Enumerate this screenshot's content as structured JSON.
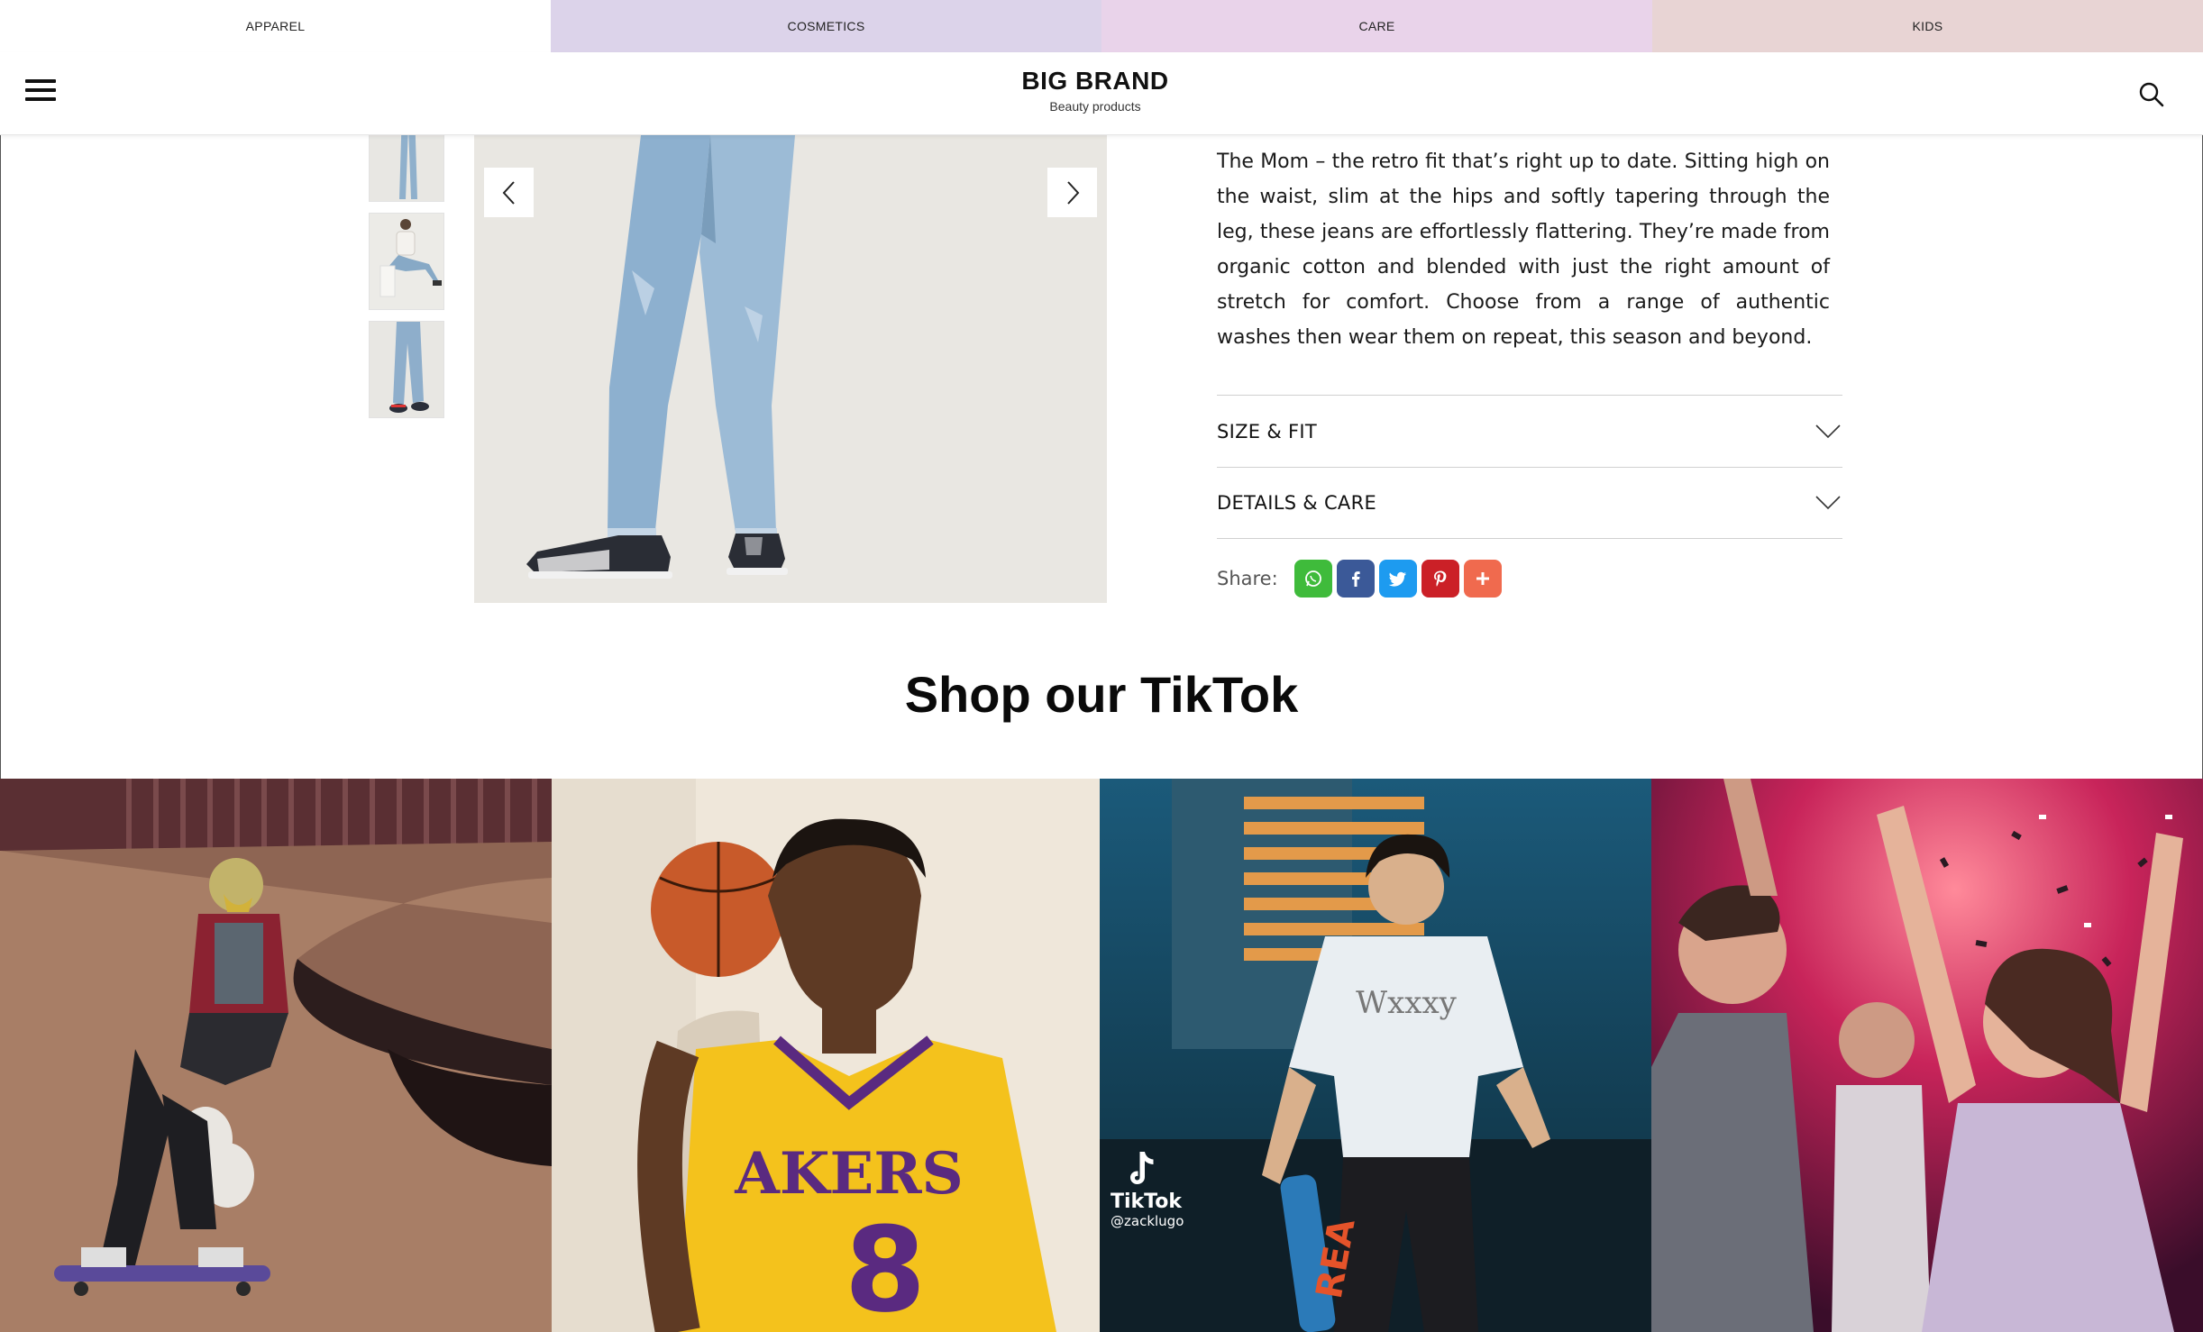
{
  "categories": [
    "APPAREL",
    "COSMETICS",
    "CARE",
    "KIDS"
  ],
  "brand": {
    "name": "BIG BRAND",
    "tagline": "Beauty products"
  },
  "product": {
    "description": "The Mom – the retro fit that’s right up to date. Sitting high on the waist, slim at the hips and softly tapering through the leg, these jeans are effortlessly flattering. They’re made from organic cotton and blended with just the right amount of stretch for comfort. Choose from a range of authentic washes then wear them on repeat, this season and beyond.",
    "accordions": [
      "SIZE & FIT",
      "DETAILS & CARE"
    ],
    "share_label": "Share:",
    "share_buttons": [
      {
        "icon": "whatsapp-icon",
        "color": "#3fbb3b"
      },
      {
        "icon": "facebook-icon",
        "color": "#3b5998"
      },
      {
        "icon": "twitter-icon",
        "color": "#1d9bf0"
      },
      {
        "icon": "pinterest-icon",
        "color": "#cb2027"
      },
      {
        "icon": "plus-icon",
        "color": "#f06a4e"
      }
    ]
  },
  "tiktok": {
    "title": "Shop our TikTok",
    "watermark_brand": "TikTok",
    "watermark_user": "@zacklugo"
  },
  "colors": {
    "tab_apparel": "#ffffff",
    "tab_cosmetics": "#dcd3ea",
    "tab_care": "#e9d3ea",
    "tab_kids": "#e8d4d4"
  }
}
